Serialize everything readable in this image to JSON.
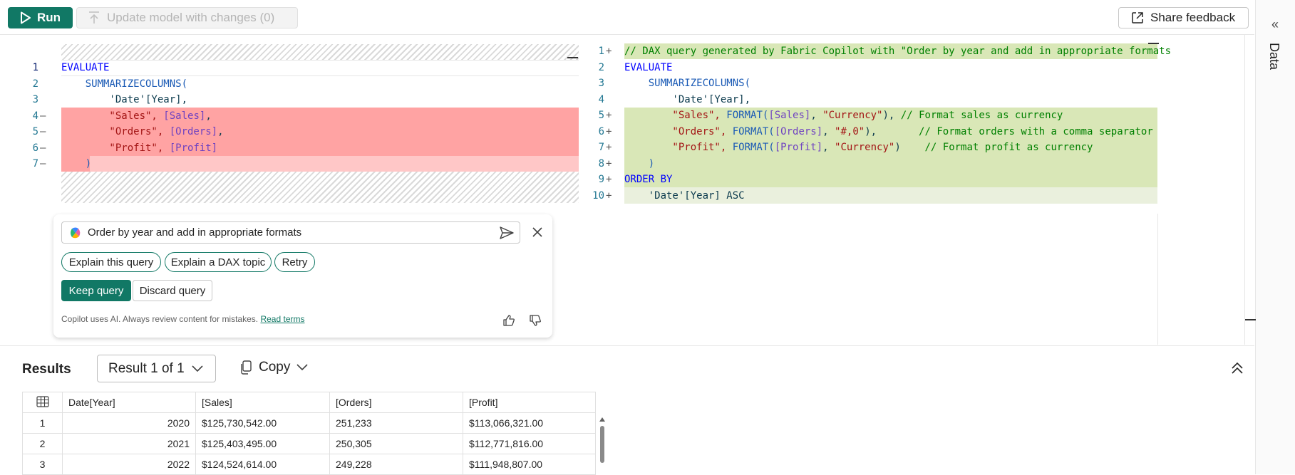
{
  "toolbar": {
    "run_label": "Run",
    "update_label": "Update model with changes (0)",
    "feedback_label": "Share feedback"
  },
  "right_rail": {
    "label": "Data"
  },
  "original_query": {
    "lines": [
      {
        "num": "1",
        "marker": "",
        "tokens": [
          {
            "t": "EVALUATE",
            "c": "kw"
          }
        ]
      },
      {
        "num": "2",
        "marker": "",
        "tokens": [
          {
            "t": "    SUMMARIZECOLUMNS(",
            "c": "fn"
          }
        ]
      },
      {
        "num": "3",
        "marker": "",
        "tokens": [
          {
            "t": "        'Date'[Year],",
            "c": "plain"
          }
        ]
      },
      {
        "num": "4",
        "marker": "—",
        "tokens": [
          {
            "t": "        \"Sales\", ",
            "c": "str"
          },
          {
            "t": "[Sales]",
            "c": "ref"
          },
          {
            "t": ",",
            "c": "plain"
          }
        ]
      },
      {
        "num": "5",
        "marker": "—",
        "tokens": [
          {
            "t": "        \"Orders\", ",
            "c": "str"
          },
          {
            "t": "[Orders]",
            "c": "ref"
          },
          {
            "t": ",",
            "c": "plain"
          }
        ]
      },
      {
        "num": "6",
        "marker": "—",
        "tokens": [
          {
            "t": "        \"Profit\", ",
            "c": "str"
          },
          {
            "t": "[Profit]",
            "c": "ref"
          }
        ]
      },
      {
        "num": "7",
        "marker": "—",
        "tokens": [
          {
            "t": "    )",
            "c": "fn"
          }
        ]
      }
    ]
  },
  "suggested_query": {
    "lines": [
      {
        "num": "1",
        "marker": "+",
        "tokens": [
          {
            "t": "// DAX query generated by Fabric Copilot with \"Order by year and add in appropriate formats",
            "c": "cmt"
          }
        ]
      },
      {
        "num": "2",
        "marker": "",
        "tokens": [
          {
            "t": "EVALUATE",
            "c": "kw"
          }
        ]
      },
      {
        "num": "3",
        "marker": "",
        "tokens": [
          {
            "t": "    SUMMARIZECOLUMNS(",
            "c": "fn"
          }
        ]
      },
      {
        "num": "4",
        "marker": "",
        "tokens": [
          {
            "t": "        'Date'[Year],",
            "c": "plain"
          }
        ]
      },
      {
        "num": "5",
        "marker": "+",
        "tokens": [
          {
            "t": "        \"Sales\", ",
            "c": "str"
          },
          {
            "t": "FORMAT(",
            "c": "fn"
          },
          {
            "t": "[Sales]",
            "c": "ref"
          },
          {
            "t": ", ",
            "c": "plain"
          },
          {
            "t": "\"Currency\"",
            "c": "str"
          },
          {
            "t": "), ",
            "c": "plain"
          },
          {
            "t": "// Format sales as currency",
            "c": "cmt"
          }
        ]
      },
      {
        "num": "6",
        "marker": "+",
        "tokens": [
          {
            "t": "        \"Orders\", ",
            "c": "str"
          },
          {
            "t": "FORMAT(",
            "c": "fn"
          },
          {
            "t": "[Orders]",
            "c": "ref"
          },
          {
            "t": ", ",
            "c": "plain"
          },
          {
            "t": "\"#,0\"",
            "c": "str"
          },
          {
            "t": "),       ",
            "c": "plain"
          },
          {
            "t": "// Format orders with a comma separator",
            "c": "cmt"
          }
        ]
      },
      {
        "num": "7",
        "marker": "+",
        "tokens": [
          {
            "t": "        \"Profit\", ",
            "c": "str"
          },
          {
            "t": "FORMAT(",
            "c": "fn"
          },
          {
            "t": "[Profit]",
            "c": "ref"
          },
          {
            "t": ", ",
            "c": "plain"
          },
          {
            "t": "\"Currency\"",
            "c": "str"
          },
          {
            "t": ")    ",
            "c": "plain"
          },
          {
            "t": "// Format profit as currency",
            "c": "cmt"
          }
        ]
      },
      {
        "num": "8",
        "marker": "+",
        "tokens": [
          {
            "t": "    )",
            "c": "fn"
          }
        ]
      },
      {
        "num": "9",
        "marker": "+",
        "tokens": [
          {
            "t": "ORDER BY",
            "c": "kw"
          }
        ]
      },
      {
        "num": "10",
        "marker": "+",
        "tokens": [
          {
            "t": "    'Date'[Year] ASC",
            "c": "plain"
          }
        ]
      }
    ]
  },
  "copilot": {
    "prompt_value": "Order by year and add in appropriate formats",
    "suggestions": [
      "Explain this query",
      "Explain a DAX topic",
      "Retry"
    ],
    "keep_label": "Keep query",
    "discard_label": "Discard query",
    "disclaimer": "Copilot uses AI. Always review content for mistakes.",
    "read_terms": "Read terms"
  },
  "results": {
    "title": "Results",
    "selector": "Result 1 of 1",
    "copy_label": "Copy",
    "columns": [
      "Date[Year]",
      "[Sales]",
      "[Orders]",
      "[Profit]"
    ],
    "rows": [
      {
        "n": "1",
        "year": "2020",
        "sales": "$125,730,542.00",
        "orders": "251,233",
        "profit": "$113,066,321.00"
      },
      {
        "n": "2",
        "year": "2021",
        "sales": "$125,403,495.00",
        "orders": "250,305",
        "profit": "$112,771,816.00"
      },
      {
        "n": "3",
        "year": "2022",
        "sales": "$124,524,614.00",
        "orders": "249,228",
        "profit": "$111,948,807.00"
      }
    ]
  },
  "colors": {
    "accent": "#117865",
    "removed_line": "#ffa3a3",
    "added_line": "#d9e7b7"
  }
}
